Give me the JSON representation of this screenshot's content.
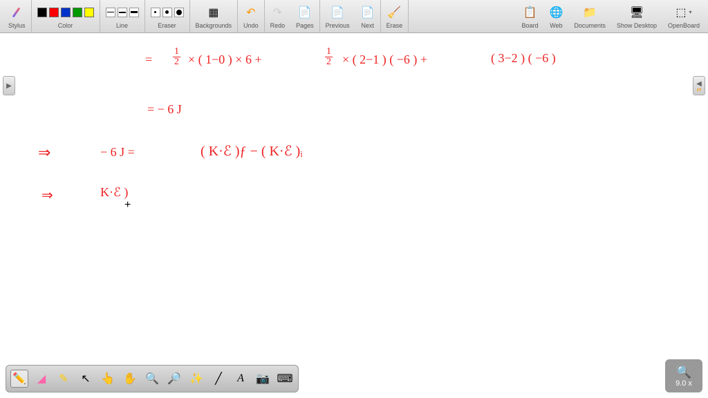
{
  "toolbar": {
    "stylus": "Stylus",
    "color": "Color",
    "line": "Line",
    "eraser": "Eraser",
    "backgrounds": "Backgrounds",
    "undo": "Undo",
    "redo": "Redo",
    "pages": "Pages",
    "previous": "Previous",
    "next": "Next",
    "erase": "Erase",
    "board": "Board",
    "web": "Web",
    "documents": "Documents",
    "showdesktop": "Show Desktop",
    "openboard": "OpenBoard",
    "colors": [
      "#000000",
      "#ff0000",
      "#0033cc",
      "#009900",
      "#ffff00"
    ]
  },
  "handwriting": {
    "line1_eq": "=",
    "line1_frac_a": "½",
    "line1_part1": "× ( 1−0 ) × 6  +",
    "line1_part2": "× ( 2−1 ) ( −6 )  +",
    "line1_part3": "( 3−2 ) ( −6 )",
    "line2": "=  − 6 J",
    "line3_arrow": "⇒",
    "line3_lhs": "− 6 J =",
    "line3_rhs": "( K·ℰ )ƒ  − ( K·ℰ )ᵢ",
    "line4_arrow": "⇒",
    "line4": "K·ℰ )"
  },
  "zoom": {
    "level": "9.0 x"
  }
}
